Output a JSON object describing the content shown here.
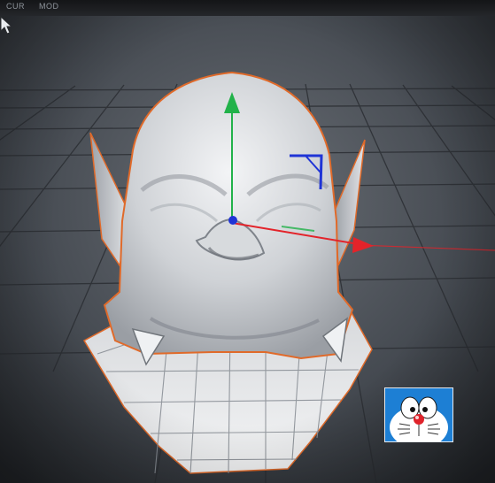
{
  "window": {
    "menu_items": [
      "CUR",
      "MOD"
    ]
  },
  "viewport": {
    "object": "head-mesh",
    "selection_outline_color": "#e06a2a",
    "axis_colors": {
      "x": "#e3232a",
      "y": "#22b24a",
      "z": "#1f34d6"
    }
  },
  "overlay": {
    "sticker": "doraemon-sticker",
    "colors": {
      "blue": "#1d7fd4",
      "nose": "#e0232b"
    }
  }
}
